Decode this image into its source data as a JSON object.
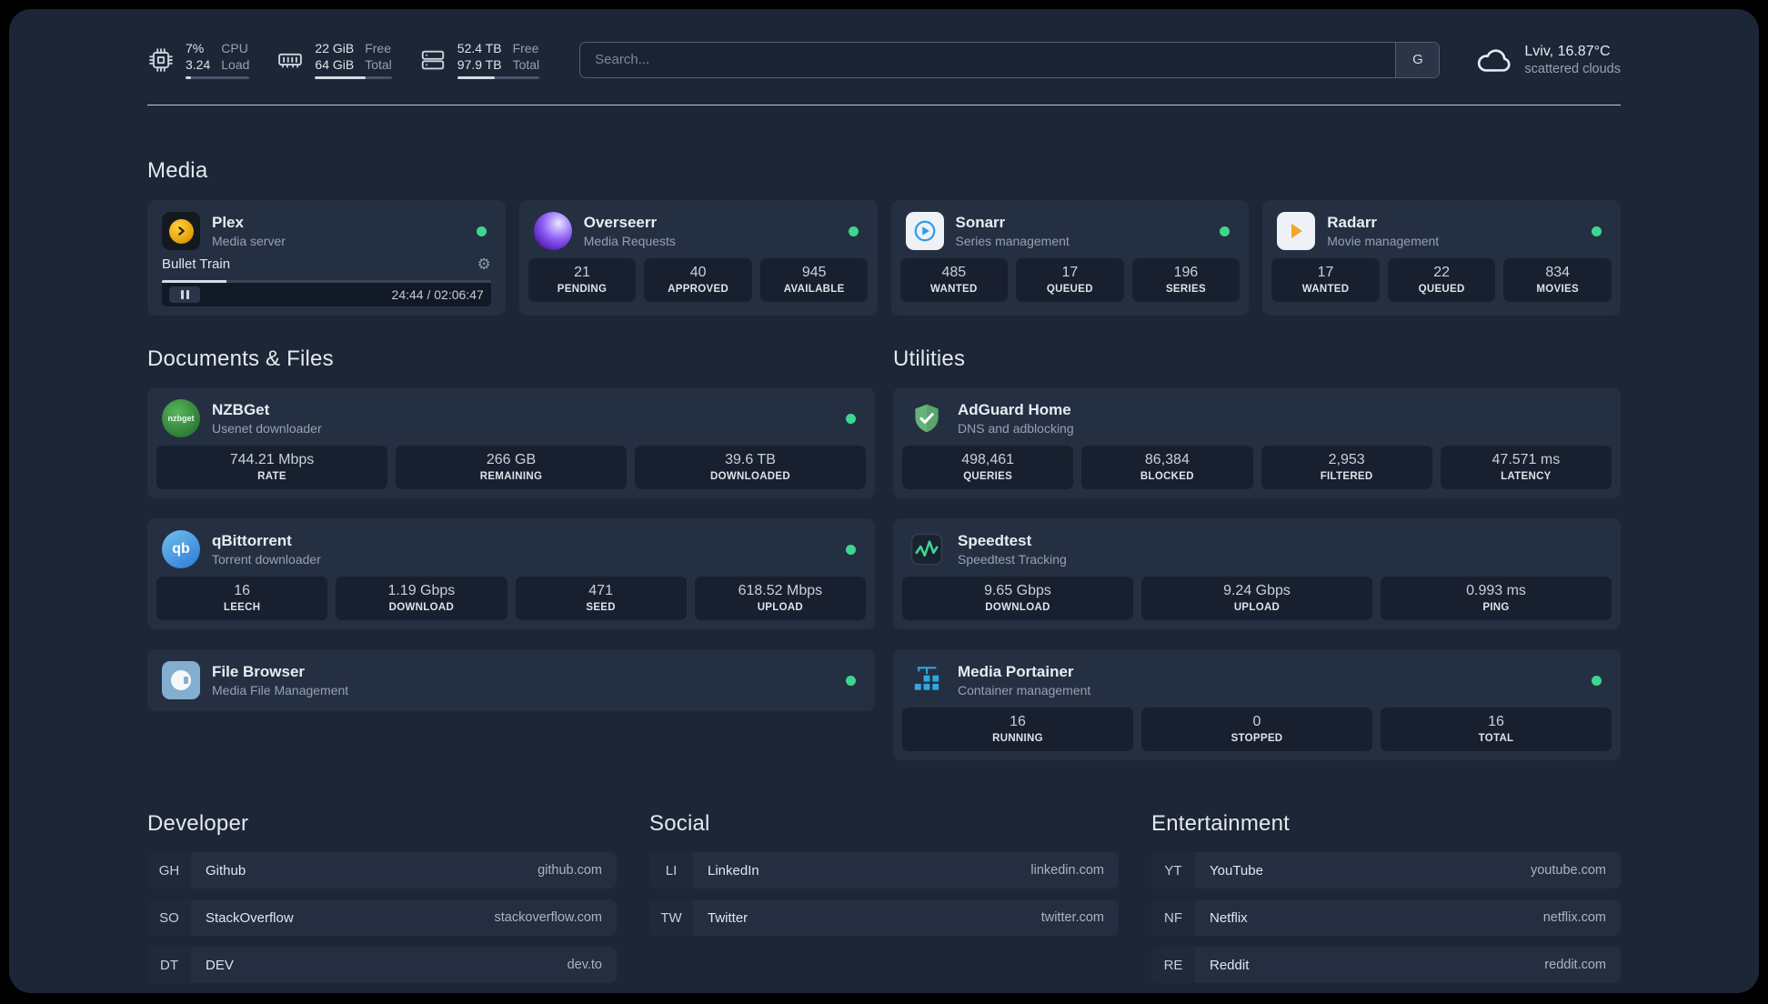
{
  "colors": {
    "status_online": "#3dd68f",
    "accent_plex": "#e5a00d",
    "accent_adguard": "#67b279",
    "accent_portainer": "#2ea8e0",
    "accent_speedtest": "#41d693"
  },
  "header": {
    "cpu": {
      "value_line1": "7%",
      "value_line2": "3.24",
      "label_line1": "CPU",
      "label_line2": "Load",
      "progress_pct": 9
    },
    "memory": {
      "value_line1": "22 GiB",
      "value_line2": "64 GiB",
      "label_line1": "Free",
      "label_line2": "Total",
      "progress_pct": 66
    },
    "disk": {
      "value_line1": "52.4 TB",
      "value_line2": "97.9 TB",
      "label_line1": "Free",
      "label_line2": "Total",
      "progress_pct": 46
    },
    "search": {
      "placeholder": "Search...",
      "provider_button": "G"
    },
    "weather": {
      "location": "Lviv, 16.87°C",
      "condition": "scattered clouds"
    }
  },
  "sections": {
    "media": "Media",
    "documents": "Documents & Files",
    "utilities": "Utilities",
    "developer": "Developer",
    "social": "Social",
    "entertainment": "Entertainment"
  },
  "services": {
    "plex": {
      "name": "Plex",
      "description": "Media server",
      "now_playing": {
        "title": "Bullet Train",
        "time": "24:44 / 02:06:47",
        "progress_pct": 19.5
      }
    },
    "overseerr": {
      "name": "Overseerr",
      "description": "Media Requests",
      "stats": [
        {
          "value": "21",
          "label": "PENDING"
        },
        {
          "value": "40",
          "label": "APPROVED"
        },
        {
          "value": "945",
          "label": "AVAILABLE"
        }
      ]
    },
    "sonarr": {
      "name": "Sonarr",
      "description": "Series management",
      "stats": [
        {
          "value": "485",
          "label": "WANTED"
        },
        {
          "value": "17",
          "label": "QUEUED"
        },
        {
          "value": "196",
          "label": "SERIES"
        }
      ]
    },
    "radarr": {
      "name": "Radarr",
      "description": "Movie management",
      "stats": [
        {
          "value": "17",
          "label": "WANTED"
        },
        {
          "value": "22",
          "label": "QUEUED"
        },
        {
          "value": "834",
          "label": "MOVIES"
        }
      ]
    },
    "nzbget": {
      "name": "NZBGet",
      "description": "Usenet downloader",
      "icon_text": "nzbget",
      "stats": [
        {
          "value": "744.21 Mbps",
          "label": "RATE"
        },
        {
          "value": "266 GB",
          "label": "REMAINING"
        },
        {
          "value": "39.6 TB",
          "label": "DOWNLOADED"
        }
      ]
    },
    "qbittorrent": {
      "name": "qBittorrent",
      "description": "Torrent downloader",
      "icon_text": "qb",
      "stats": [
        {
          "value": "16",
          "label": "LEECH"
        },
        {
          "value": "1.19 Gbps",
          "label": "DOWNLOAD"
        },
        {
          "value": "471",
          "label": "SEED"
        },
        {
          "value": "618.52 Mbps",
          "label": "UPLOAD"
        }
      ]
    },
    "filebrowser": {
      "name": "File Browser",
      "description": "Media File Management"
    },
    "adguard": {
      "name": "AdGuard Home",
      "description": "DNS and adblocking",
      "stats": [
        {
          "value": "498,461",
          "label": "QUERIES"
        },
        {
          "value": "86,384",
          "label": "BLOCKED"
        },
        {
          "value": "2,953",
          "label": "FILTERED"
        },
        {
          "value": "47.571 ms",
          "label": "LATENCY"
        }
      ]
    },
    "speedtest": {
      "name": "Speedtest",
      "description": "Speedtest Tracking",
      "stats": [
        {
          "value": "9.65 Gbps",
          "label": "DOWNLOAD"
        },
        {
          "value": "9.24 Gbps",
          "label": "UPLOAD"
        },
        {
          "value": "0.993 ms",
          "label": "PING"
        }
      ]
    },
    "portainer": {
      "name": "Media Portainer",
      "description": "Container management",
      "stats": [
        {
          "value": "16",
          "label": "RUNNING"
        },
        {
          "value": "0",
          "label": "STOPPED"
        },
        {
          "value": "16",
          "label": "TOTAL"
        }
      ]
    }
  },
  "bookmarks": {
    "developer": [
      {
        "abbr": "GH",
        "name": "Github",
        "domain": "github.com"
      },
      {
        "abbr": "SO",
        "name": "StackOverflow",
        "domain": "stackoverflow.com"
      },
      {
        "abbr": "DT",
        "name": "DEV",
        "domain": "dev.to"
      }
    ],
    "social": [
      {
        "abbr": "LI",
        "name": "LinkedIn",
        "domain": "linkedin.com"
      },
      {
        "abbr": "TW",
        "name": "Twitter",
        "domain": "twitter.com"
      }
    ],
    "entertainment": [
      {
        "abbr": "YT",
        "name": "YouTube",
        "domain": "youtube.com"
      },
      {
        "abbr": "NF",
        "name": "Netflix",
        "domain": "netflix.com"
      },
      {
        "abbr": "RE",
        "name": "Reddit",
        "domain": "reddit.com"
      }
    ]
  }
}
